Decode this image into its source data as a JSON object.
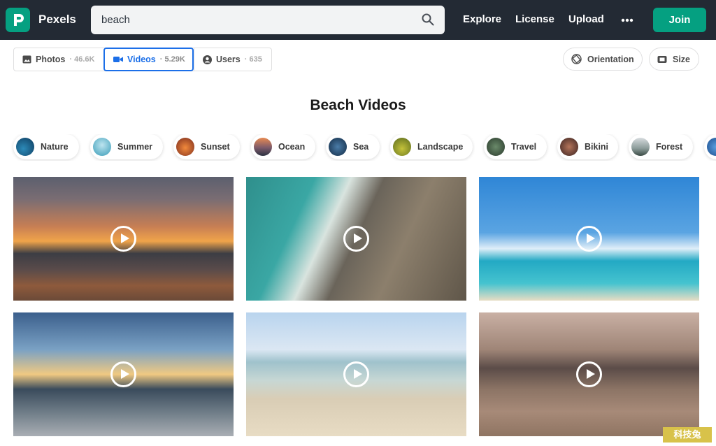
{
  "header": {
    "brand": "Pexels",
    "logo_icon": "pexels-logo-icon",
    "search_value": "beach",
    "nav": [
      "Explore",
      "License",
      "Upload"
    ],
    "join_label": "Join"
  },
  "filters": {
    "tabs": [
      {
        "label": "Photos",
        "count": "· 46.6K"
      },
      {
        "label": "Videos",
        "count": "· 5.29K"
      },
      {
        "label": "Users",
        "count": "· 635"
      }
    ],
    "orientation_label": "Orientation",
    "size_label": "Size"
  },
  "page_title": "Beach Videos",
  "categories": [
    "Nature",
    "Summer",
    "Sunset",
    "Ocean",
    "Sea",
    "Landscape",
    "Travel",
    "Bikini",
    "Forest"
  ],
  "watermark": "科技兔",
  "colors": {
    "header_bg": "#232a34",
    "accent": "#05a081",
    "active_tab": "#1c6fe8"
  }
}
